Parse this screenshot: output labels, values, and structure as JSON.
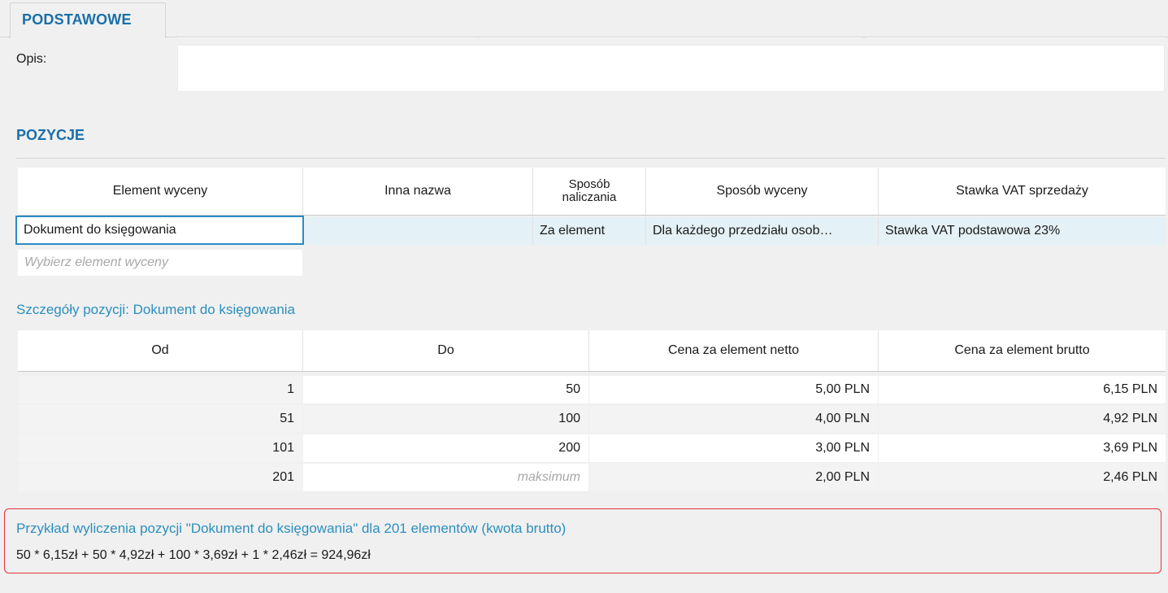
{
  "tabs": [
    {
      "label": "PODSTAWOWE"
    }
  ],
  "opis": {
    "label": "Opis:",
    "value": ""
  },
  "pozycje": {
    "section_title": "POZYCJE",
    "columns": [
      "Element wyceny",
      "Inna nazwa",
      "Sposób\nnaliczania",
      "Sposób wyceny",
      "Stawka VAT sprzedaży"
    ],
    "rows": [
      {
        "element": "Dokument do księgowania",
        "inna_nazwa": "",
        "sposob_naliczania": "Za element",
        "sposob_wyceny": "Dla każdego przedziału osob…",
        "stawka_vat": "Stawka VAT podstawowa 23%"
      }
    ],
    "new_row_placeholder": "Wybierz element wyceny"
  },
  "details": {
    "title": "Szczegóły pozycji: Dokument do księgowania",
    "columns": [
      "Od",
      "Do",
      "Cena za element netto",
      "Cena za element brutto"
    ],
    "rows": [
      {
        "od": "1",
        "do": "50",
        "netto": "5,00 PLN",
        "brutto": "6,15 PLN"
      },
      {
        "od": "51",
        "do": "100",
        "netto": "4,00 PLN",
        "brutto": "4,92 PLN"
      },
      {
        "od": "101",
        "do": "200",
        "netto": "3,00 PLN",
        "brutto": "3,69 PLN"
      },
      {
        "od": "201",
        "do": "maksimum",
        "netto": "2,00 PLN",
        "brutto": "2,46 PLN"
      }
    ]
  },
  "example": {
    "title": "Przykład wyliczenia pozycji \"Dokument do księgowania\" dla 201 elementów (kwota brutto)",
    "formula": "50 * 6,15zł + 50 * 4,92zł + 100 * 3,69zł + 1 * 2,46zł = 924,96zł"
  },
  "colors": {
    "accent": "#1a6fa8",
    "link": "#2b8fbe",
    "highlight_border": "#e0343a",
    "selection": "#e4f1f7"
  }
}
